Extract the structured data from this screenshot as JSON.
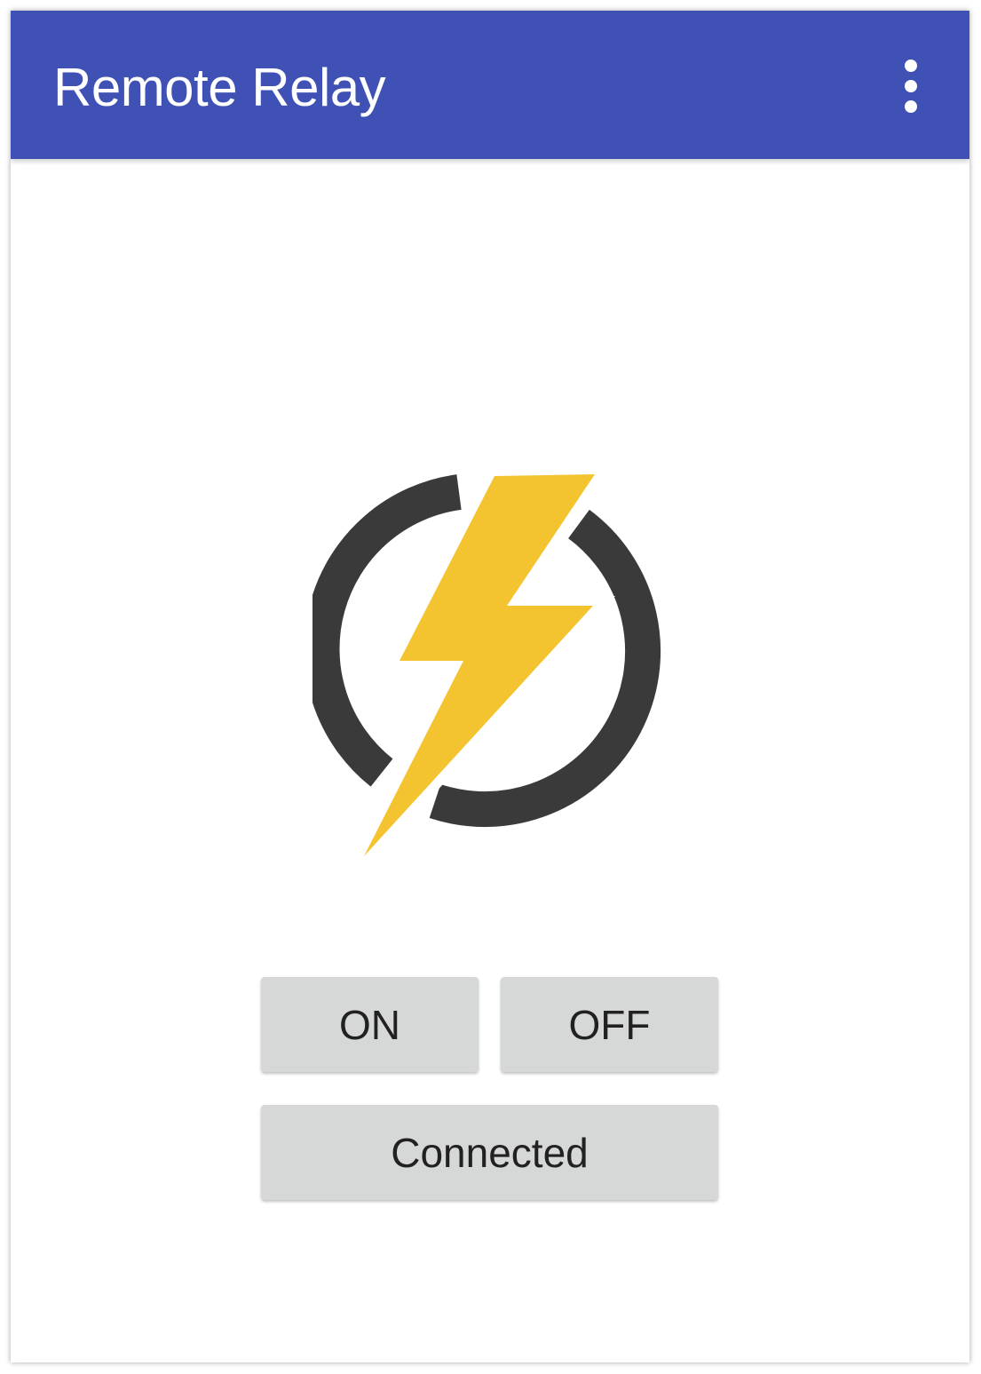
{
  "app_bar": {
    "title": "Remote Relay",
    "menu_icon": "more-vert-icon",
    "background_color": "#3f51b5"
  },
  "logo": {
    "icon": "lightning-power-icon",
    "bolt_color": "#f4c430",
    "ring_color": "#3a3a3a"
  },
  "controls": {
    "on_label": "ON",
    "off_label": "OFF",
    "status_label": "Connected",
    "button_color": "#d6d7d7"
  }
}
